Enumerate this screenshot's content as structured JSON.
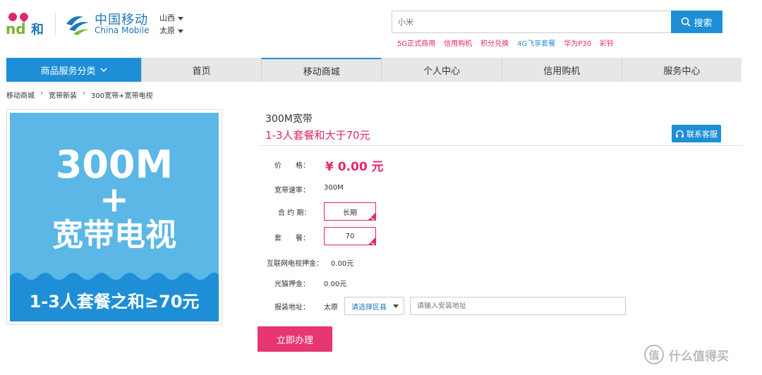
{
  "header": {
    "and_logo_text": "and",
    "and_logo_he": "和",
    "brand_cn": "中国移动",
    "brand_en": "China Mobile",
    "province": "山西",
    "city": "太原"
  },
  "search": {
    "placeholder": "小米",
    "button_label": "搜索",
    "hot_links": [
      {
        "label": "5G正式商用",
        "color": "red"
      },
      {
        "label": "信用购机",
        "color": "red"
      },
      {
        "label": "积分兑换",
        "color": "red"
      },
      {
        "label": "4G飞享套餐",
        "color": "blue"
      },
      {
        "label": "华为P30",
        "color": "red"
      },
      {
        "label": "彩铃",
        "color": "red"
      }
    ]
  },
  "nav": {
    "category_label": "商品服务分类",
    "items": [
      "首页",
      "移动商城",
      "个人中心",
      "信用购机",
      "服务中心"
    ],
    "active_index": 1
  },
  "breadcrumb": [
    "移动商城",
    "宽带新装",
    "300宽带+宽带电视"
  ],
  "product_image": {
    "line1": "300M",
    "line2": "+",
    "line3": "宽带电视",
    "line4": "1-3人套餐之和≥70元"
  },
  "product": {
    "title": "300M宽带",
    "subtitle": "1-3人套餐和大于70元",
    "service_label": "联系客服",
    "price_label": "价　　格：",
    "price_value": "¥ 0.00 元",
    "speed_label": "宽带速率：",
    "speed_value": "300M",
    "contract_label": "合 约 期：",
    "contract_value": "长期",
    "package_label": "套　　餐：",
    "package_value": "70",
    "tv_deposit_label": "互联网电视押金：",
    "tv_deposit_value": "0.00元",
    "modem_deposit_label": "光猫押金：",
    "modem_deposit_value": "0.00元",
    "address_label": "报装地址：",
    "address_city": "太原",
    "district_placeholder": "请选择区县",
    "address_placeholder": "请输入安装地址",
    "submit_label": "立即办理"
  },
  "watermark": {
    "text": "什么值得买",
    "logo": "值"
  },
  "colors": {
    "brand_blue": "#1e8fd6",
    "accent_pink": "#e2266a",
    "submit_pink": "#e83770"
  }
}
